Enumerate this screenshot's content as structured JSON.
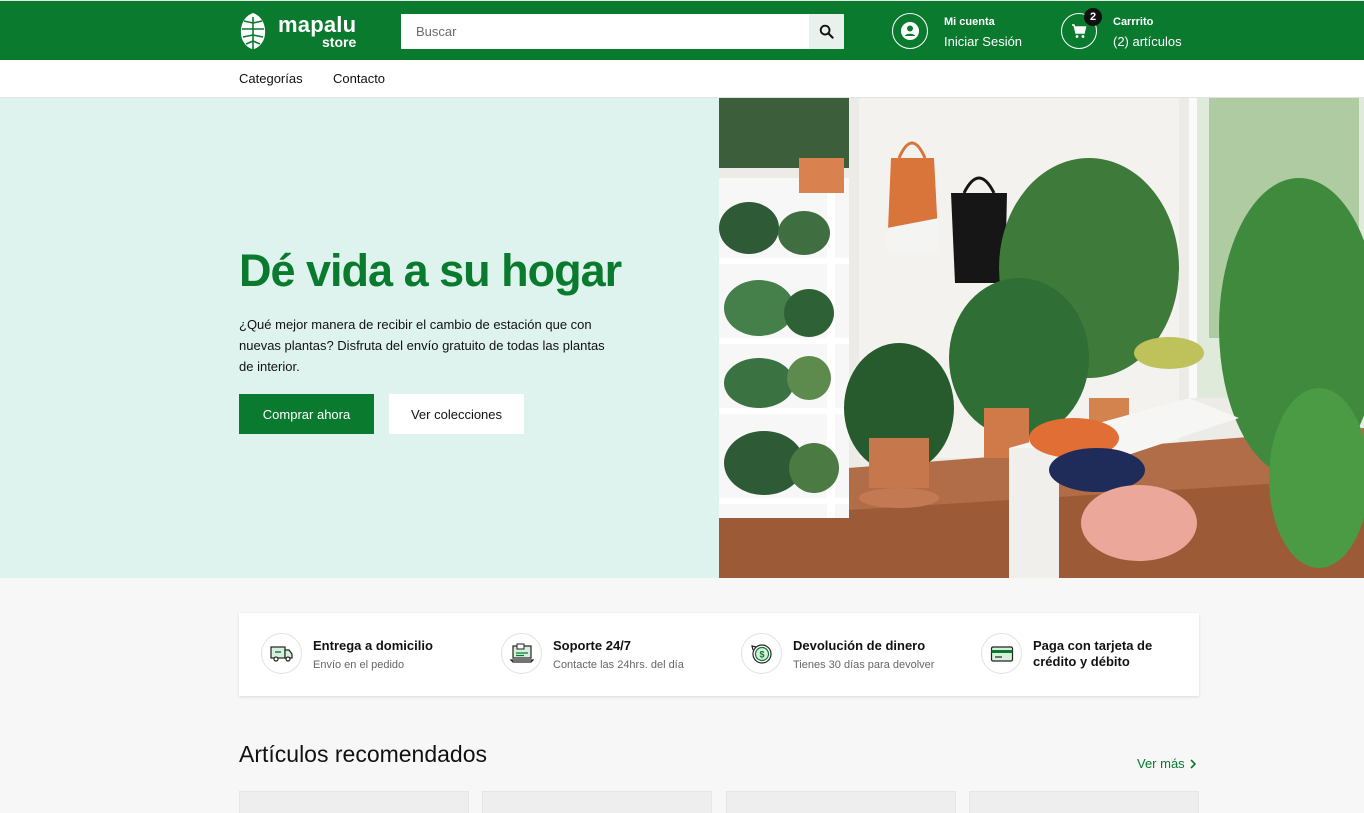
{
  "header": {
    "logo_name": "mapalu",
    "logo_sub": "store",
    "search_placeholder": "Buscar",
    "account_small": "Mi cuenta",
    "account_big": "Iniciar Sesión",
    "cart_small": "Carrrito",
    "cart_big": "(2) artículos",
    "cart_count": "2"
  },
  "nav": {
    "items": [
      "Categorías",
      "Contacto"
    ]
  },
  "hero": {
    "title": "Dé vida a su hogar",
    "text": "¿Qué mejor manera de recibir el cambio de estación que con nuevas plantas? Disfruta del envío gratuito de todas las plantas de interior.",
    "primary_label": "Comprar ahora",
    "secondary_label": "Ver colecciones"
  },
  "features": [
    {
      "title": "Entrega a domicilio",
      "sub": "Envío en el pedido",
      "icon": "delivery-truck-icon"
    },
    {
      "title": "Soporte 24/7",
      "sub": "Contacte las 24hrs. del día",
      "icon": "support-laptop-icon"
    },
    {
      "title": "Devolución de dinero",
      "sub": "Tienes 30 días para devolver",
      "icon": "money-back-icon"
    },
    {
      "title": "Paga con tarjeta de crédito y débito",
      "sub": "",
      "icon": "credit-card-icon"
    }
  ],
  "recommended": {
    "title": "Artículos recomendados",
    "see_more": "Ver más"
  },
  "colors": {
    "brand_green": "#0a7a2f",
    "hero_bg": "#def3ee"
  }
}
